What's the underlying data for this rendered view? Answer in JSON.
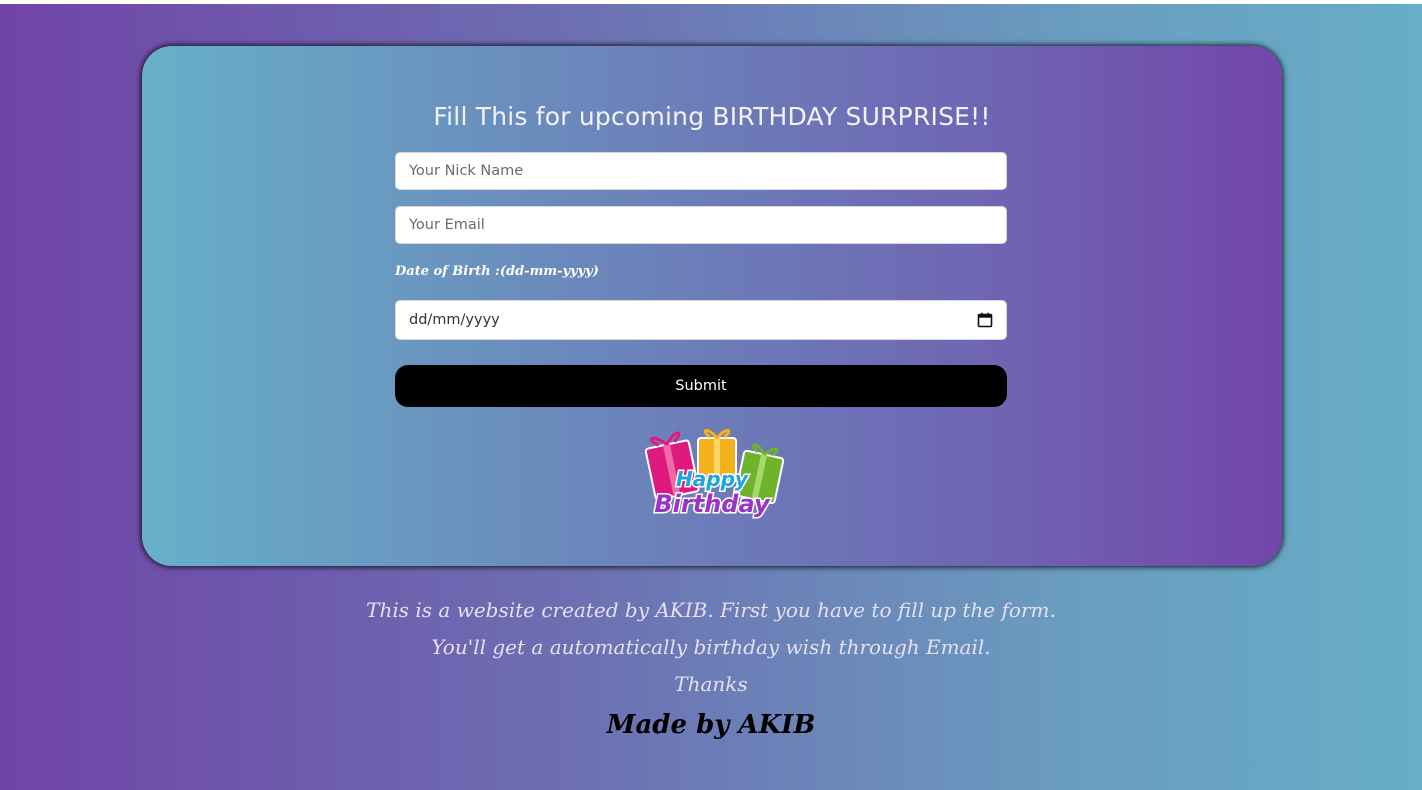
{
  "form": {
    "title": "Fill This for upcoming BIRTHDAY SURPRISE!!",
    "nick_name_placeholder": "Your Nick Name",
    "email_placeholder": "Your Email",
    "dob_label": "Date of Birth :(dd-mm-yyyy)",
    "dob_placeholder": "dd/mm/yyyy",
    "submit_label": "Submit"
  },
  "logo": {
    "top_text": "Happy",
    "bottom_text": "Birthday",
    "colors": {
      "pink_box": "#e0197f",
      "yellow_box": "#f6b21c",
      "green_box": "#6fb32c",
      "happy_text": "#1aa5e0",
      "birthday_text": "#9b34c5"
    }
  },
  "footer": {
    "line1": "This is a website created by AKIB. First you have to fill up the form.",
    "line2": "You'll get a automatically birthday wish through Email.",
    "line3": "Thanks",
    "made_by": "Made by AKIB"
  },
  "colors": {
    "page_gradient": [
      "#7044a8",
      "#67aec6"
    ],
    "card_gradient": [
      "#67b0c8",
      "#7346ab"
    ],
    "button_bg": "#000000",
    "button_text": "#ffffff"
  }
}
